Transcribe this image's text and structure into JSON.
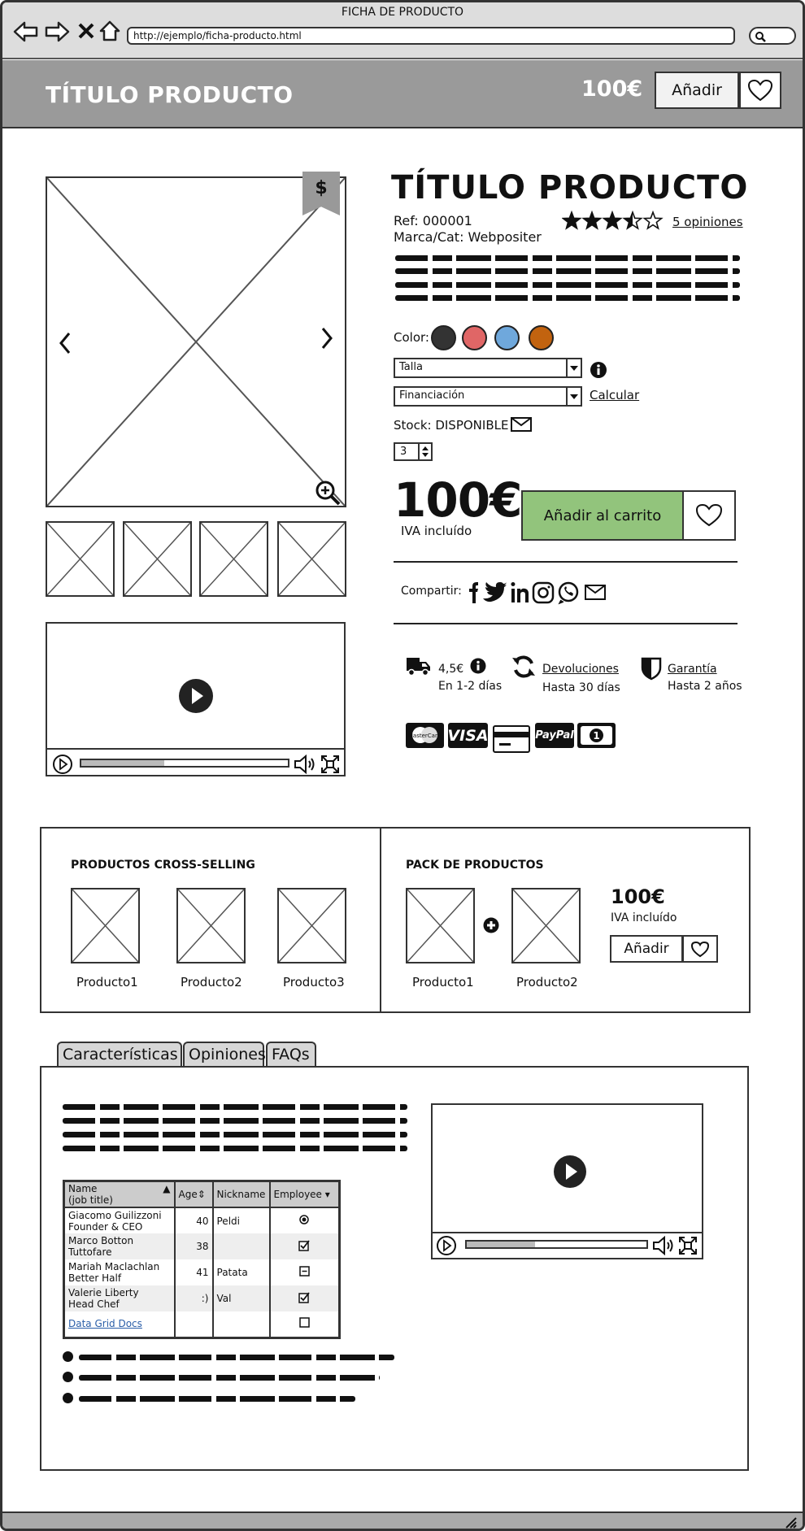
{
  "window": {
    "title": "FICHA DE PRODUCTO",
    "url": "http://ejemplo/ficha-producto.html"
  },
  "header": {
    "title": "TÍTULO PRODUCTO",
    "price": "100€",
    "add_label": "Añadir"
  },
  "product": {
    "title": "TÍTULO PRODUCTO",
    "ref": "Ref: 000001",
    "brand": "Marca/Cat: Webpositer",
    "rating": 3.5,
    "reviews_link": "5 opiniones",
    "badge": "$",
    "color_label": "Color:",
    "colors": [
      "#333333",
      "#e06666",
      "#6fa8dc",
      "#c2630f"
    ],
    "size_select": "Talla",
    "finance_select": "Financiación",
    "calc_link": "Calcular",
    "stock": "Stock: DISPONIBLE",
    "quantity": "3",
    "price": "100€",
    "vat": "IVA incluído",
    "add_to_cart": "Añadir al carrito",
    "share_label": "Compartir:"
  },
  "shipping": {
    "cost": "4,5€",
    "time": "En 1-2 días",
    "returns_link": "Devoluciones",
    "returns_desc": "Hasta 30 días",
    "warranty_link": "Garantía",
    "warranty_desc": "Hasta 2 años"
  },
  "payments": [
    "MasterCard",
    "VISA",
    "card",
    "PayPal",
    "1"
  ],
  "cross_selling": {
    "title": "PRODUCTOS CROSS-SELLING",
    "items": [
      "Producto1",
      "Producto2",
      "Producto3"
    ]
  },
  "pack": {
    "title": "PACK DE PRODUCTOS",
    "items": [
      "Producto1",
      "Producto2"
    ],
    "price": "100€",
    "vat": "IVA incluído",
    "add_label": "Añadir"
  },
  "tabs": [
    "Características",
    "Opiniones",
    "FAQs"
  ],
  "grid": {
    "headers": [
      "Name\n(job title)",
      "Age",
      "Nickname",
      "Employee"
    ],
    "rows": [
      {
        "name": "Giacomo Guilizzoni",
        "job": "Founder & CEO",
        "age": "40",
        "nick": "Peldi",
        "emp": "radio"
      },
      {
        "name": "Marco Botton",
        "job": "Tuttofare",
        "age": "38",
        "nick": "",
        "emp": "checked"
      },
      {
        "name": "Mariah Maclachlan",
        "job": "Better Half",
        "age": "41",
        "nick": "Patata",
        "emp": "indeterminate"
      },
      {
        "name": "Valerie Liberty",
        "job": "Head Chef",
        "age": ":)",
        "nick": "Val",
        "emp": "checked"
      }
    ],
    "link_label": "Data Grid Docs",
    "header_name_1": "Name",
    "header_name_2": "(job title)",
    "header_age": "Age",
    "header_nick": "Nickname",
    "header_emp": "Employee"
  }
}
